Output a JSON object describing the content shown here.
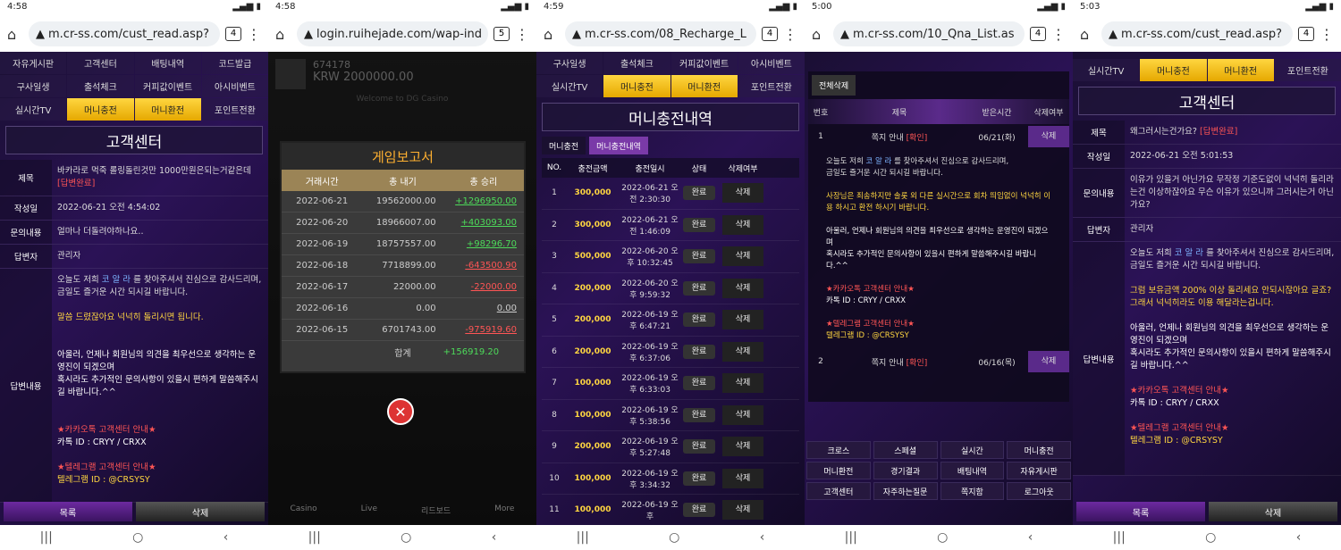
{
  "panels": [
    {
      "time": "4:58",
      "url": "m.cr-ss.com/cust_read.asp?",
      "tabs": "4"
    },
    {
      "time": "4:58",
      "url": "login.ruihejade.com/wap-ind",
      "tabs": "5"
    },
    {
      "time": "4:59",
      "url": "m.cr-ss.com/08_Recharge_L",
      "tabs": "4"
    },
    {
      "time": "5:00",
      "url": "m.cr-ss.com/10_Qna_List.as",
      "tabs": "4"
    },
    {
      "time": "5:03",
      "url": "m.cr-ss.com/cust_read.asp?",
      "tabs": "4"
    }
  ],
  "p1": {
    "menu": [
      "자유게시판",
      "고객센터",
      "배팅내역",
      "코드발급",
      "구사일생",
      "출석체크",
      "커피값이벤트",
      "아시비벤트",
      "실시간TV",
      "머니충전",
      "머니환전",
      "포인트전환"
    ],
    "title": "고객센터",
    "subject_k": "제목",
    "subject_v": "바카라로 먹죽 롤링돌린것만 1000만원은되는거같은데",
    "subject_tag": "[답변완료]",
    "date_k": "작성일",
    "date_v": "2022-06-21 오전 4:54:02",
    "q_k": "문의내용",
    "q_v": "얼마나 더돌려야하나요..",
    "author_k": "답변자",
    "author_v": "관리자",
    "ans_k": "답변내용",
    "ans1": "오늘도 저희",
    "ans1b": "코 알 라",
    "ans1c": "를 찾아주셔서 진심으로 감사드리며,",
    "ans2": "금일도 즐거운 시간 되시길 바랍니다.",
    "ans3": "말씀 드렸잖아요 넉넉히 돌리시면 됩니다.",
    "ans4": "아울러, 언제나 회원님의 의견을 최우선으로 생각하는 운영진이 되겠으며",
    "ans5": "혹시라도 추가적인 문의사항이 있을시 편하게 말씀해주시길 바랍니다.^^",
    "kakao": "★카카오톡 고객센터 안내★",
    "kakao_id": "카톡 ID : CRYY / CRXX",
    "tele": "★텔레그램 고객센터 안내★",
    "tele_id": "텔레그램 ID : @CRSYSY",
    "btn_list": "목록",
    "btn_del": "삭제"
  },
  "p2": {
    "user": "674178",
    "balance": "KRW 2000000.00",
    "welcome": "Welcome to DG Casino",
    "modal_title": "게임보고서",
    "headers": [
      "거래시간",
      "총 내기",
      "총 승리"
    ],
    "rows": [
      [
        "2022-06-21",
        "19562000.00",
        "+1296950.00",
        "g"
      ],
      [
        "2022-06-20",
        "18966007.00",
        "+403093.00",
        "g"
      ],
      [
        "2022-06-19",
        "18757557.00",
        "+98296.70",
        "g"
      ],
      [
        "2022-06-18",
        "7718899.00",
        "-643500.90",
        "r"
      ],
      [
        "2022-06-17",
        "22000.00",
        "-22000.00",
        "r"
      ],
      [
        "2022-06-16",
        "0.00",
        "0.00",
        "n"
      ],
      [
        "2022-06-15",
        "6701743.00",
        "-975919.60",
        "r"
      ]
    ],
    "total_label": "합계",
    "total_value": "+156919.20",
    "bottom": [
      "Casino",
      "Live",
      "리드보드",
      "More"
    ]
  },
  "p3": {
    "menu": [
      "구사일생",
      "출석체크",
      "커피값이벤트",
      "아시비벤트",
      "실시간TV",
      "머니충전",
      "머니환전",
      "포인트전환"
    ],
    "title": "머니충전내역",
    "subtabs": [
      "머니충전",
      "머니충전내역"
    ],
    "headers": [
      "NO.",
      "충전금액",
      "충전일시",
      "상태",
      "삭제여부"
    ],
    "rows": [
      [
        "1",
        "300,000",
        "2022-06-21 오전 2:30:30"
      ],
      [
        "2",
        "300,000",
        "2022-06-21 오전 1:46:09"
      ],
      [
        "3",
        "500,000",
        "2022-06-20 오후 10:32:45"
      ],
      [
        "4",
        "200,000",
        "2022-06-20 오후 9:59:32"
      ],
      [
        "5",
        "200,000",
        "2022-06-19 오후 6:47:21"
      ],
      [
        "6",
        "200,000",
        "2022-06-19 오후 6:37:06"
      ],
      [
        "7",
        "100,000",
        "2022-06-19 오후 6:33:03"
      ],
      [
        "8",
        "100,000",
        "2022-06-19 오후 5:38:56"
      ],
      [
        "9",
        "200,000",
        "2022-06-19 오후 5:27:48"
      ],
      [
        "10",
        "100,000",
        "2022-06-19 오후 3:34:32"
      ],
      [
        "11",
        "100,000",
        "2022-06-19 오후"
      ]
    ],
    "status": "완료",
    "delete": "삭제"
  },
  "p4": {
    "delete_all": "전체삭제",
    "headers": [
      "번호",
      "제목",
      "받은시간",
      "삭제여부"
    ],
    "r1": [
      "1",
      "쪽지 안내",
      "[확인]",
      "06/21(화)",
      "삭제"
    ],
    "m1": "오늘도 저희",
    "m1b": "코 알 라",
    "m1c": "를 찾아주셔서 진심으로 감사드리며,",
    "m2": "금일도 즐거운 시간 되시길 바랍니다.",
    "m3": "사장님은 죄송하지만 솔롯 외 다른 실시간으로 회차 띄임없이 넉넉히 이용 하시고 환전 하시기 바랍니다.",
    "m4": "아울러, 언제나 회원님의 의견을 최우선으로 생각하는 운영진이 되겠으며",
    "m5": "혹시라도 추가적인 문의사항이 있을시 편하게 말씀해주시길 바랍니다.^^",
    "kakao": "★카카오톡 고객센터 안내★",
    "kakao_id": "카톡 ID : CRYY / CRXX",
    "tele": "★텔레그램 고객센터 안내★",
    "tele_id": "텔레그램 ID : @CRSYSY",
    "r2": [
      "2",
      "쪽지 안내",
      "[확인]",
      "06/16(목)",
      "삭제"
    ],
    "grid": [
      "크로스",
      "스페셜",
      "실시간",
      "머니충전",
      "머니환전",
      "경기결과",
      "배팅내역",
      "자유게시판",
      "고객센터",
      "자주하는질문",
      "쪽지함",
      "로그아웃"
    ]
  },
  "p5": {
    "menu": [
      "실시간TV",
      "머니충전",
      "머니환전",
      "포인트전환"
    ],
    "title": "고객센터",
    "subject_k": "제목",
    "subject_v": "왜그러시는건가요?",
    "subject_tag": "[답변완료]",
    "date_k": "작성일",
    "date_v": "2022-06-21 오전 5:01:53",
    "q_k": "문의내용",
    "q_v": "이유가 있을거 아닌가요 무작정 기준도없이 넉넉히 돌리라는건 이상하잖아요 무슨 이유가 있으니까 그러시는거 아닌가요?",
    "author_k": "답변자",
    "author_v": "관리자",
    "ans_k": "답변내용",
    "ans1": "오늘도 저희",
    "ans1b": "코 알 라",
    "ans1c": "를 찾아주셔서 진심으로 감사드리며,",
    "ans2": "금일도 즐거운 시간 되시길 바랍니다.",
    "ans3": "그럼 보유금액 200% 이상 돌리세요 안되시잖아요 글죠? 그래서 넉넉히라도 이용 해달라는겁니다.",
    "ans4": "아울러, 언제나 회원님의 의견을 최우선으로 생각하는 운영진이 되겠으며",
    "ans5": "혹시라도 추가적인 문의사항이 있을시 편하게 말씀해주시길 바랍니다.^^",
    "kakao": "★카카오톡 고객센터 안내★",
    "kakao_id": "카톡 ID : CRYY / CRXX",
    "tele": "★텔레그램 고객센터 안내★",
    "tele_id": "텔레그램 ID : @CRSYSY",
    "btn_list": "목록",
    "btn_del": "삭제"
  }
}
